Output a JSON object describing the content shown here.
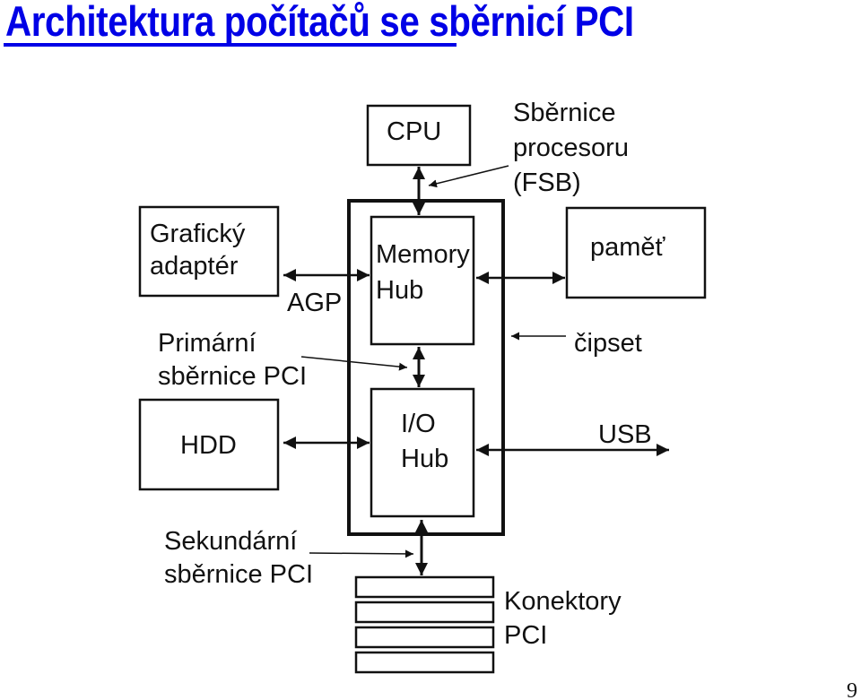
{
  "title": "Architektura počítačů se sběrnicí PCI",
  "page_number": "9",
  "colors": {
    "title": "#0000e6",
    "lines": "#111111"
  },
  "blocks": {
    "cpu": "CPU",
    "memory_hub": [
      "Memory",
      "Hub"
    ],
    "io_hub": [
      "I/O",
      "Hub"
    ],
    "graphics_adapter": [
      "Grafický",
      "adaptér"
    ],
    "hdd": "HDD",
    "memory": "paměť"
  },
  "labels": {
    "fsb": [
      "Sběrnice",
      "procesoru",
      "(FSB)"
    ],
    "agp": "AGP",
    "primary_pci": [
      "Primární",
      "sběrnice PCI"
    ],
    "chipset": "čipset",
    "usb": "USB",
    "secondary_pci": [
      "Sekundární",
      "sběrnice PCI"
    ],
    "pci_connectors": [
      "Konektory",
      "PCI"
    ]
  },
  "pci_slot_count": 4
}
